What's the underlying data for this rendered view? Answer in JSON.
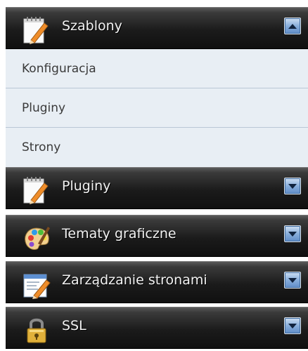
{
  "menu": {
    "sections": [
      {
        "title": "Szablony",
        "icon": "notepad-pencil-icon",
        "expanded": true,
        "items": [
          "Konfiguracja",
          "Pluginy",
          "Strony"
        ]
      },
      {
        "title": "Pluginy",
        "icon": "notepad-pencil-icon",
        "expanded": false
      },
      {
        "title": "Tematy graficzne",
        "icon": "palette-icon",
        "expanded": false
      },
      {
        "title": "Zarządzanie stronami",
        "icon": "page-edit-icon",
        "expanded": false
      },
      {
        "title": "SSL",
        "icon": "padlock-icon",
        "expanded": false
      }
    ]
  }
}
